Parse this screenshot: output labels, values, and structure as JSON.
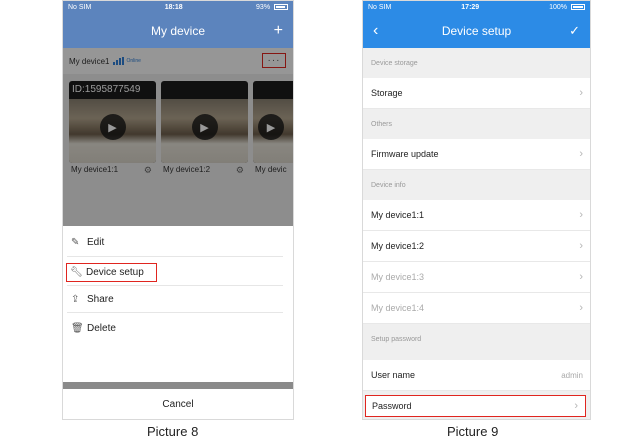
{
  "picture8": {
    "status": {
      "carrier": "No SIM",
      "time": "18:18",
      "battery": "93%"
    },
    "nav": {
      "title": "My device",
      "add_icon": "plus-icon"
    },
    "device": {
      "name": "My device1",
      "status": "Online"
    },
    "more_button": "···",
    "cameras": [
      {
        "id_text": "ID:1595877549",
        "label": "My device1:1"
      },
      {
        "id_text": "",
        "label": "My device1:2"
      },
      {
        "id_text": "",
        "label": "My devic"
      }
    ],
    "sheet": {
      "items": [
        {
          "icon": "pencil-icon",
          "label": "Edit"
        },
        {
          "icon": "wrench-icon",
          "label": "Device setup"
        },
        {
          "icon": "share-icon",
          "label": "Share"
        },
        {
          "icon": "trash-icon",
          "label": "Delete"
        }
      ],
      "cancel": "Cancel"
    },
    "caption": "Picture 8"
  },
  "picture9": {
    "status": {
      "carrier": "No SIM",
      "time": "17:29",
      "battery": "100%"
    },
    "nav": {
      "title": "Device setup",
      "back": "‹",
      "confirm": "✓"
    },
    "sections": [
      {
        "header": "Device storage",
        "rows": [
          {
            "label": "Storage"
          }
        ]
      },
      {
        "header": "Others",
        "rows": [
          {
            "label": "Firmware update"
          }
        ]
      },
      {
        "header": "Device info",
        "rows": [
          {
            "label": "My device1:1"
          },
          {
            "label": "My device1:2"
          },
          {
            "label": "My device1:3"
          },
          {
            "label": "My device1:4"
          }
        ]
      },
      {
        "header": "Setup password",
        "rows": [
          {
            "label": "User name",
            "value": "admin"
          },
          {
            "label": "Password"
          }
        ]
      }
    ],
    "caption": "Picture 9"
  },
  "colors": {
    "nav8": "#5c84bd",
    "nav9": "#2c8be6",
    "highlight": "#e0251f"
  }
}
